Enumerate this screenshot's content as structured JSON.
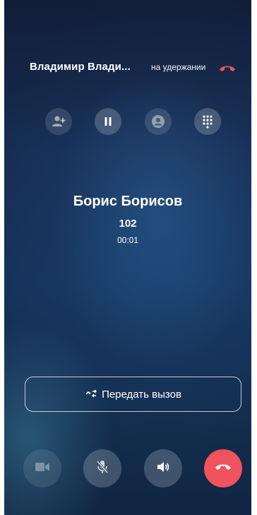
{
  "held_call": {
    "name": "Владимир Влади...",
    "status": "на удержании"
  },
  "actions": [
    {
      "icon": "add-person-icon"
    },
    {
      "icon": "pause-icon"
    },
    {
      "icon": "contact-icon"
    },
    {
      "icon": "dialpad-icon"
    }
  ],
  "active_call": {
    "name": "Борис Борисов",
    "number": "102",
    "timer": "00:01"
  },
  "transfer": {
    "label": "Передать вызов",
    "icon": "transfer-icon"
  },
  "controls": [
    {
      "icon": "video-icon"
    },
    {
      "icon": "mic-off-icon"
    },
    {
      "icon": "speaker-icon"
    },
    {
      "icon": "hangup-icon"
    }
  ],
  "colors": {
    "hangup": "#f0525e",
    "background_top": "#15233f",
    "background_mid": "#1b4171"
  }
}
